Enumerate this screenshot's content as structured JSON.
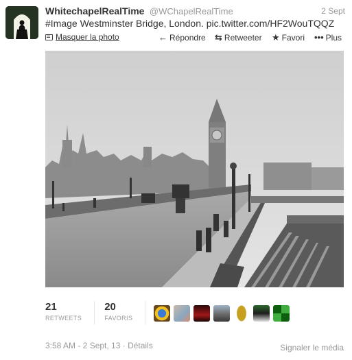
{
  "tweet": {
    "fullname": "WhitechapelRealTime",
    "username": "@WChapelRealTime",
    "date": "2 Sept",
    "text_hashtag": "#Image",
    "text_body": " Westminster Bridge, London. ",
    "text_link": "pic.twitter.com/HF2WouTQQZ"
  },
  "actions": {
    "hide_photo": "Masquer la photo",
    "reply": "Répondre",
    "retweet": "Retweeter",
    "favorite": "Favori",
    "more": "Plus"
  },
  "stats": {
    "retweets_count": "21",
    "retweets_label": "RETWEETS",
    "favorites_count": "20",
    "favorites_label": "FAVORIS"
  },
  "footer": {
    "timestamp": "3:58 AM - 2 Sept, 13",
    "separator": " · ",
    "details": "Détails",
    "report": "Signaler le média"
  },
  "icons": {
    "reply": "reply-arrow-icon",
    "retweet": "retweet-icon",
    "favorite": "star-icon",
    "more": "ellipsis-icon",
    "hide_photo": "photo-icon"
  },
  "colors": {
    "text": "#333333",
    "muted": "#999999"
  }
}
